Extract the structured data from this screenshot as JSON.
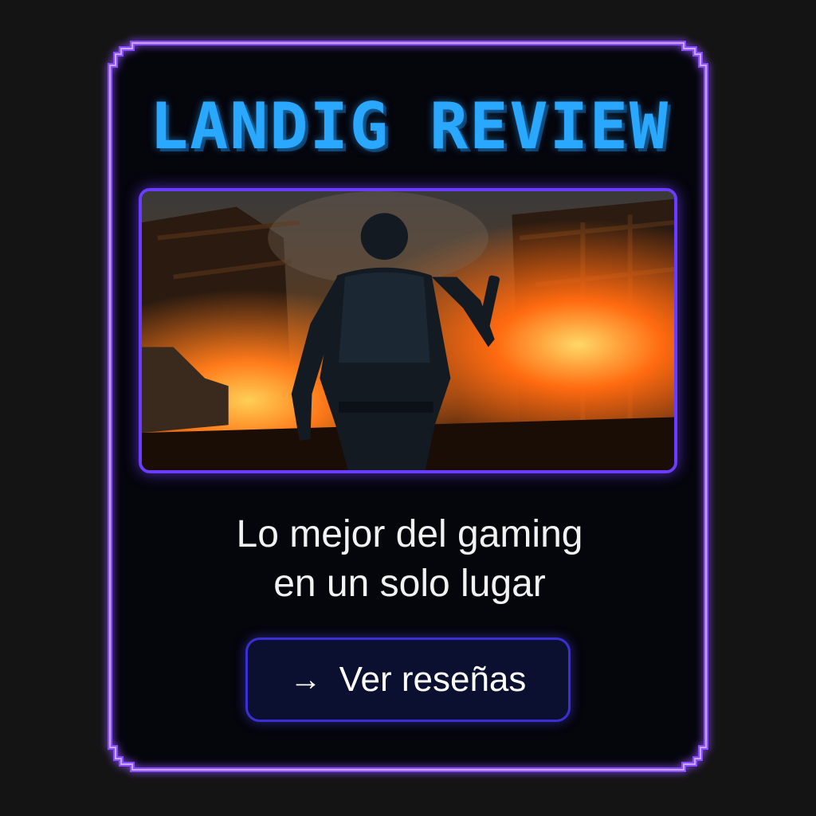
{
  "header": {
    "title": "LANDIG REVIEW"
  },
  "hero": {
    "image_icon": "soldier-in-burning-ruins-image"
  },
  "tagline": {
    "line1": "Lo mejor del gaming",
    "line2": "en un solo lugar"
  },
  "cta": {
    "icon": "arrow-right-icon",
    "glyph": "→",
    "label": "Ver reseñas"
  },
  "colors": {
    "background": "#141414",
    "card": "#05050c",
    "frame": "#8a4dff",
    "title": "#2aa7ff",
    "button_border": "#3a2fd0",
    "button_bg": "#0c1030"
  }
}
